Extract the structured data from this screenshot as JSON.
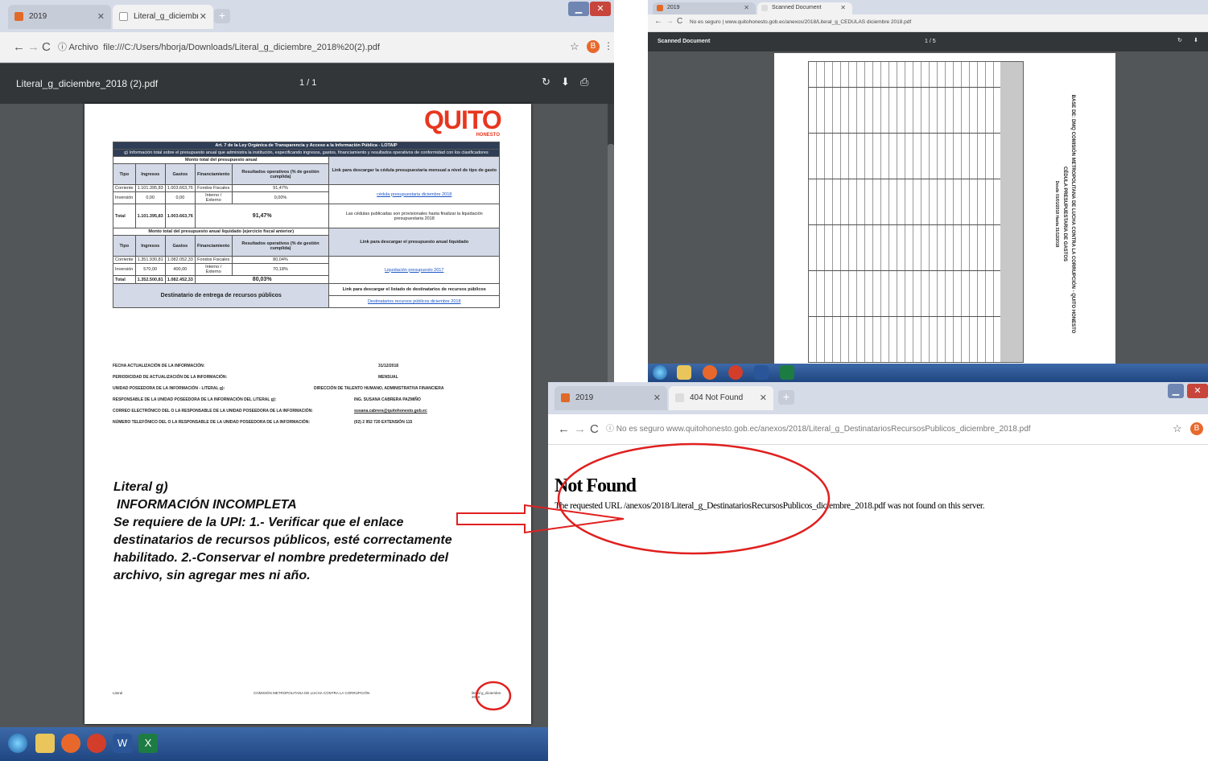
{
  "left_window": {
    "tabs": [
      {
        "label": "2019"
      },
      {
        "label": "Literal_g_diciembre_2018 (2).pdf"
      }
    ],
    "new_tab": "+",
    "address": "file:///C:/Users/hborja/Downloads/Literal_g_diciembre_2018%20(2).pdf",
    "address_prefix": "Archivo",
    "avatar": "B",
    "pdf_title": "Literal_g_diciembre_2018 (2).pdf",
    "pdf_pages": "1 / 1",
    "doc": {
      "logo": "QUITO",
      "logo_sub": "HONESTO",
      "header1": "Art. 7 de la Ley Orgánica de Transparencia y Acceso a la Información Pública - LOTAIP",
      "header2": "g) Información total sobre el presupuesto anual que administra la institución, especificando ingresos, gastos, financiamiento y resultados operativos de conformidad con los clasificadores",
      "sec1": "Monto total del presupuesto anual",
      "cols": [
        "Tipo",
        "Ingresos",
        "Gastos",
        "Financiamiento",
        "Resultados operativos (% de gestión cumplida)"
      ],
      "link1_head": "Link para descargar la cédula presupuestaria mensual a nivel de tipo de gasto",
      "rows1": [
        [
          "Corriente",
          "1.101.395,83",
          "1.003.663,76",
          "Fondos Fiscales",
          "91,47%"
        ],
        [
          "Inversión",
          "0,00",
          "0,00",
          "Interno / Externo",
          "0,00%"
        ],
        [
          "Total",
          "1.101.395,83",
          "1.003.663,76",
          "",
          "91,47%"
        ]
      ],
      "link1": "cédula presupuestaria diciembre 2018",
      "link1_note": "Las cédulas publicadas son provisionales hasta finalizar la liquidación presupuestaria 2018",
      "sec2": "Monto total del presupuesto anual liquidado (ejercicio fiscal anterior)",
      "link2_head": "Link para descargar el presupuesto anual liquidado",
      "rows2": [
        [
          "Corriente",
          "1.351.930,81",
          "1.082.052,33",
          "Fondos Fiscales",
          "80,04%"
        ],
        [
          "Inversión",
          "570,00",
          "400,00",
          "Interno / Externo",
          "70,18%"
        ],
        [
          "Total",
          "1.352.500,81",
          "1.082.452,33",
          "",
          "80,03%"
        ]
      ],
      "link2": "Liquidación presupuesto 2017",
      "dest_label": "Destinatario de entrega de recursos públicos",
      "link3_head": "Link para descargar el listado de destinatarios de recursos públicos",
      "link3": "Destinatarios recursos públicos diciembre 2018",
      "meta": [
        [
          "FECHA ACTUALIZACIÓN DE LA INFORMACIÓN:",
          "31/12/2018"
        ],
        [
          "PERIODICIDAD DE ACTUALIZACIÓN DE LA INFORMACIÓN:",
          "MENSUAL"
        ],
        [
          "UNIDAD POSEEDORA DE LA INFORMACIÓN - LITERAL g):",
          "DIRECCIÓN DE TALENTO HUMANO, ADMINISTRATIVA FINANCIERA"
        ],
        [
          "RESPONSABLE DE LA UNIDAD POSEEDORA DE LA INFORMACIÓN DEL LITERAL g):",
          "ING. SUSANA CABRERA PAZMIÑO"
        ],
        [
          "CORREO ELECTRÓNICO DEL O LA RESPONSABLE DE LA UNIDAD POSEEDORA DE LA INFORMACIÓN:",
          "susana.cabrera@quitohonesto.gob.ec"
        ],
        [
          "NÚMERO TELEFÓNICO DEL O LA RESPONSABLE DE LA UNIDAD POSEEDORA DE LA INFORMACIÓN:",
          "(02) 2 952 720 EXTENSIÓN 115"
        ]
      ],
      "footer_left": "Literal",
      "footer_mid": "COMISIÓN METROPOLITANA DE LUCHA CONTRA LA CORRUPCIÓN",
      "footer_right": "literal g_diciembre 2018"
    },
    "note": [
      "Literal g)",
      "INFORMACIÓN INCOMPLETA",
      "Se requiere de la UPI: 1.-  Verificar que el enlace",
      "destinatarios de recursos públicos, esté correctamente",
      "habilitado. 2.-Conservar el nombre predeterminado del",
      "archivo, sin agregar mes ni año."
    ]
  },
  "top_right_window": {
    "tabs": [
      {
        "label": "2019"
      },
      {
        "label": "Scanned Document"
      }
    ],
    "address": "No es seguro | www.quitohonesto.gob.ec/anexos/2018/Literal_g_CEDULAS diciembre 2018.pdf",
    "pdf_title": "Scanned Document",
    "pdf_pages": "1 / 5",
    "rotated_header": [
      "BASE DE: DMQ COMISIÓN METROPOLITANA DE LUCHA CONTRA LA CORRUPCIÓN - QUITO HONESTO",
      "CÉDULA PRESUPUESTARIA DE GASTOS",
      "Desde 01/01/2018 Hasta 31/12/2018"
    ]
  },
  "bottom_right_window": {
    "tabs": [
      {
        "label": "2019"
      },
      {
        "label": "404 Not Found"
      }
    ],
    "address": "No es seguro   www.quitohonesto.gob.ec/anexos/2018/Literal_g_DestinatariosRecursosPublicos_diciembre_2018.pdf",
    "avatar": "B",
    "heading": "Not Found",
    "message": "The requested URL /anexos/2018/Literal_g_DestinatariosRecursosPublicos_diciembre_2018.pdf was not found on this server."
  },
  "colors": {
    "accent": "#e8361f",
    "header": "#2f3e56",
    "link": "#1a55c8"
  }
}
